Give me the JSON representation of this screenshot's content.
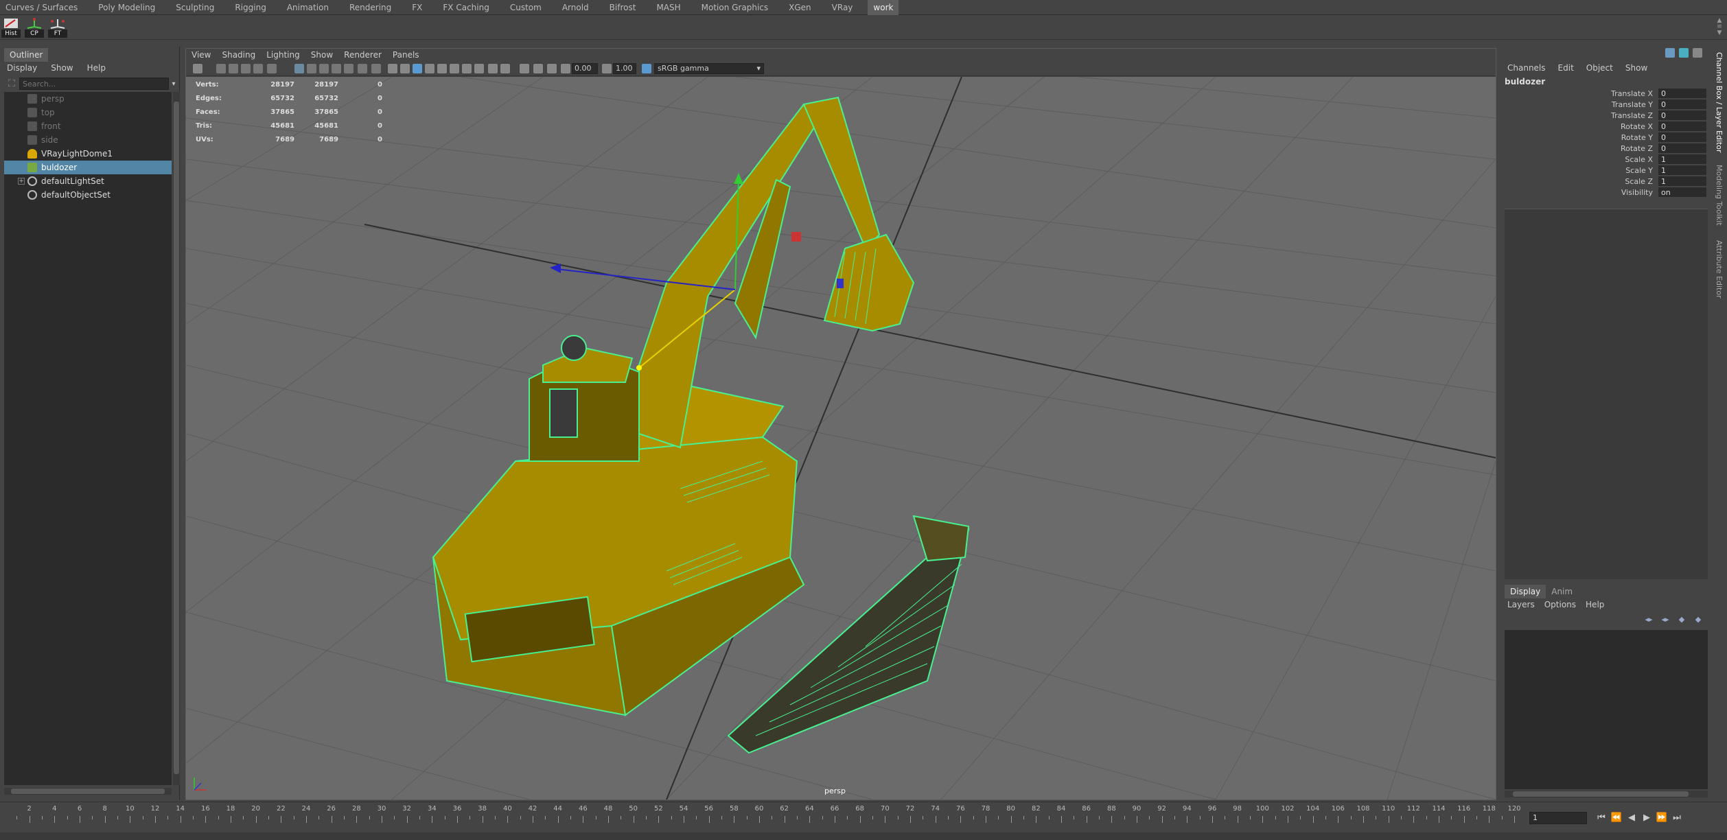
{
  "shelf_tabs": [
    "Curves / Surfaces",
    "Poly Modeling",
    "Sculpting",
    "Rigging",
    "Animation",
    "Rendering",
    "FX",
    "FX Caching",
    "Custom",
    "Arnold",
    "Bifrost",
    "MASH",
    "Motion Graphics",
    "XGen",
    "VRay",
    "work"
  ],
  "active_shelf_tab": "work",
  "shelf_buttons": [
    {
      "label": "Hist",
      "icon": "history-icon"
    },
    {
      "label": "CP",
      "icon": "center-pivot-icon"
    },
    {
      "label": "FT",
      "icon": "freeze-transform-icon"
    }
  ],
  "outliner": {
    "title": "Outliner",
    "menu": [
      "Display",
      "Show",
      "Help"
    ],
    "search_placeholder": "Search...",
    "items": [
      {
        "label": "persp",
        "icon": "camera-icon",
        "dim": true
      },
      {
        "label": "top",
        "icon": "camera-icon",
        "dim": true
      },
      {
        "label": "front",
        "icon": "camera-icon",
        "dim": true
      },
      {
        "label": "side",
        "icon": "camera-icon",
        "dim": true
      },
      {
        "label": "VRayLightDome1",
        "icon": "dome-light-icon",
        "dim": false
      },
      {
        "label": "buldozer",
        "icon": "mesh-icon",
        "dim": false,
        "selected": true
      },
      {
        "label": "defaultLightSet",
        "icon": "set-icon",
        "dim": false,
        "expandable": true
      },
      {
        "label": "defaultObjectSet",
        "icon": "set-icon",
        "dim": false
      }
    ]
  },
  "viewport": {
    "menu": [
      "View",
      "Shading",
      "Lighting",
      "Show",
      "Renderer",
      "Panels"
    ],
    "exposure": "0.00",
    "gamma": "1.00",
    "color_space": "sRGB gamma",
    "camera": "persp",
    "hud": [
      {
        "label": "Verts:",
        "a": "28197",
        "b": "28197",
        "c": "0"
      },
      {
        "label": "Edges:",
        "a": "65732",
        "b": "65732",
        "c": "0"
      },
      {
        "label": "Faces:",
        "a": "37865",
        "b": "37865",
        "c": "0"
      },
      {
        "label": "Tris:",
        "a": "45681",
        "b": "45681",
        "c": "0"
      },
      {
        "label": "UVs:",
        "a": "7689",
        "b": "7689",
        "c": "0"
      }
    ]
  },
  "channel_box": {
    "menu": [
      "Channels",
      "Edit",
      "Object",
      "Show"
    ],
    "object_name": "buldozer",
    "attributes": [
      {
        "name": "Translate X",
        "value": "0"
      },
      {
        "name": "Translate Y",
        "value": "0"
      },
      {
        "name": "Translate Z",
        "value": "0"
      },
      {
        "name": "Rotate X",
        "value": "0"
      },
      {
        "name": "Rotate Y",
        "value": "0"
      },
      {
        "name": "Rotate Z",
        "value": "0"
      },
      {
        "name": "Scale X",
        "value": "1"
      },
      {
        "name": "Scale Y",
        "value": "1"
      },
      {
        "name": "Scale Z",
        "value": "1"
      },
      {
        "name": "Visibility",
        "value": "on"
      }
    ]
  },
  "side_tabs": [
    "Channel Box / Layer Editor",
    "Modeling Toolkit",
    "Attribute Editor"
  ],
  "layer_editor": {
    "tabs": [
      "Display",
      "Anim"
    ],
    "active_tab": "Display",
    "menu": [
      "Layers",
      "Options",
      "Help"
    ]
  },
  "time_slider": {
    "start": 2,
    "end": 120,
    "step": 2,
    "current_frame": "1",
    "controls": [
      "⏮",
      "⏪",
      "◀",
      "▶",
      "⏩",
      "⏭"
    ]
  },
  "colors": {
    "selection": "#5285a6",
    "wireframe": "#48f090",
    "model_fill": "#a88c00",
    "viewport_bg": "#6b6b6b"
  }
}
